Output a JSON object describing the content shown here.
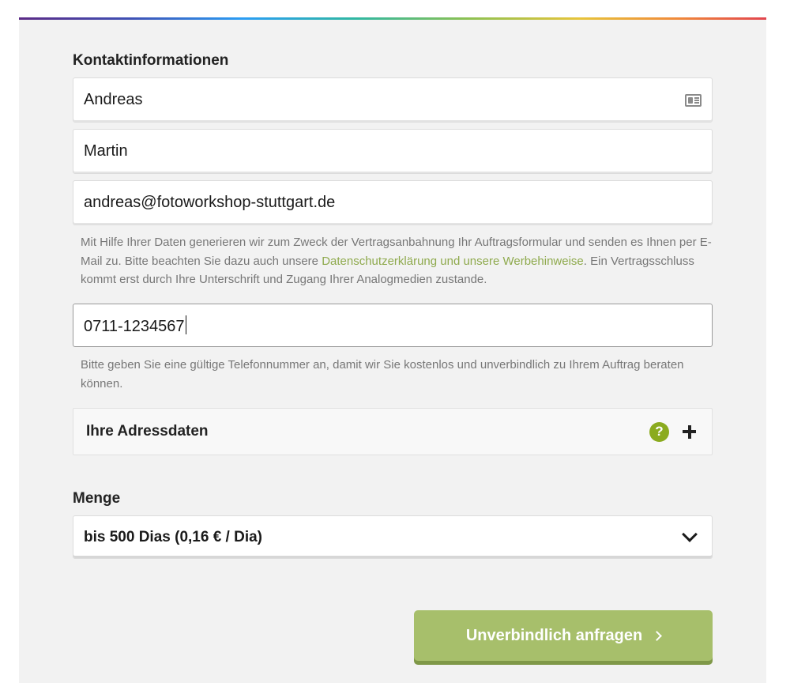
{
  "contact": {
    "title": "Kontaktinformationen",
    "first_name": "Andreas",
    "last_name": "Martin",
    "email": "andreas@fotoworkshop-stuttgart.de",
    "privacy_hint_before": "Mit Hilfe Ihrer Daten generieren wir zum Zweck der Vertragsanbahnung Ihr Auftragsformular und senden es Ihnen per E-Mail zu. Bitte beachten Sie dazu auch unsere ",
    "privacy_link": "Datenschutzerklärung und unsere Werbehinweise",
    "privacy_hint_after": ". Ein Vertragsschluss kommt erst durch Ihre Unterschrift und Zugang Ihrer Analogmedien zustande.",
    "phone": "0711-1234567",
    "phone_hint": "Bitte geben Sie eine gültige Telefonnummer an, damit wir Sie kostenlos und unverbindlich zu Ihrem Auftrag beraten können."
  },
  "address": {
    "label": "Ihre Adressdaten",
    "help_glyph": "?"
  },
  "quantity": {
    "title": "Menge",
    "selected": "bis 500 Dias (0,16 € / Dia)"
  },
  "submit": {
    "label": "Unverbindlich anfragen"
  },
  "colors": {
    "accent_green": "#a7bf6b",
    "link_green": "#8faa4e",
    "help_green": "#8bab1f",
    "panel_bg": "#f2f2f2"
  },
  "icons": [
    "contact-card-icon",
    "help-icon",
    "plus-icon",
    "chevron-down-icon",
    "chevron-right-icon"
  ]
}
